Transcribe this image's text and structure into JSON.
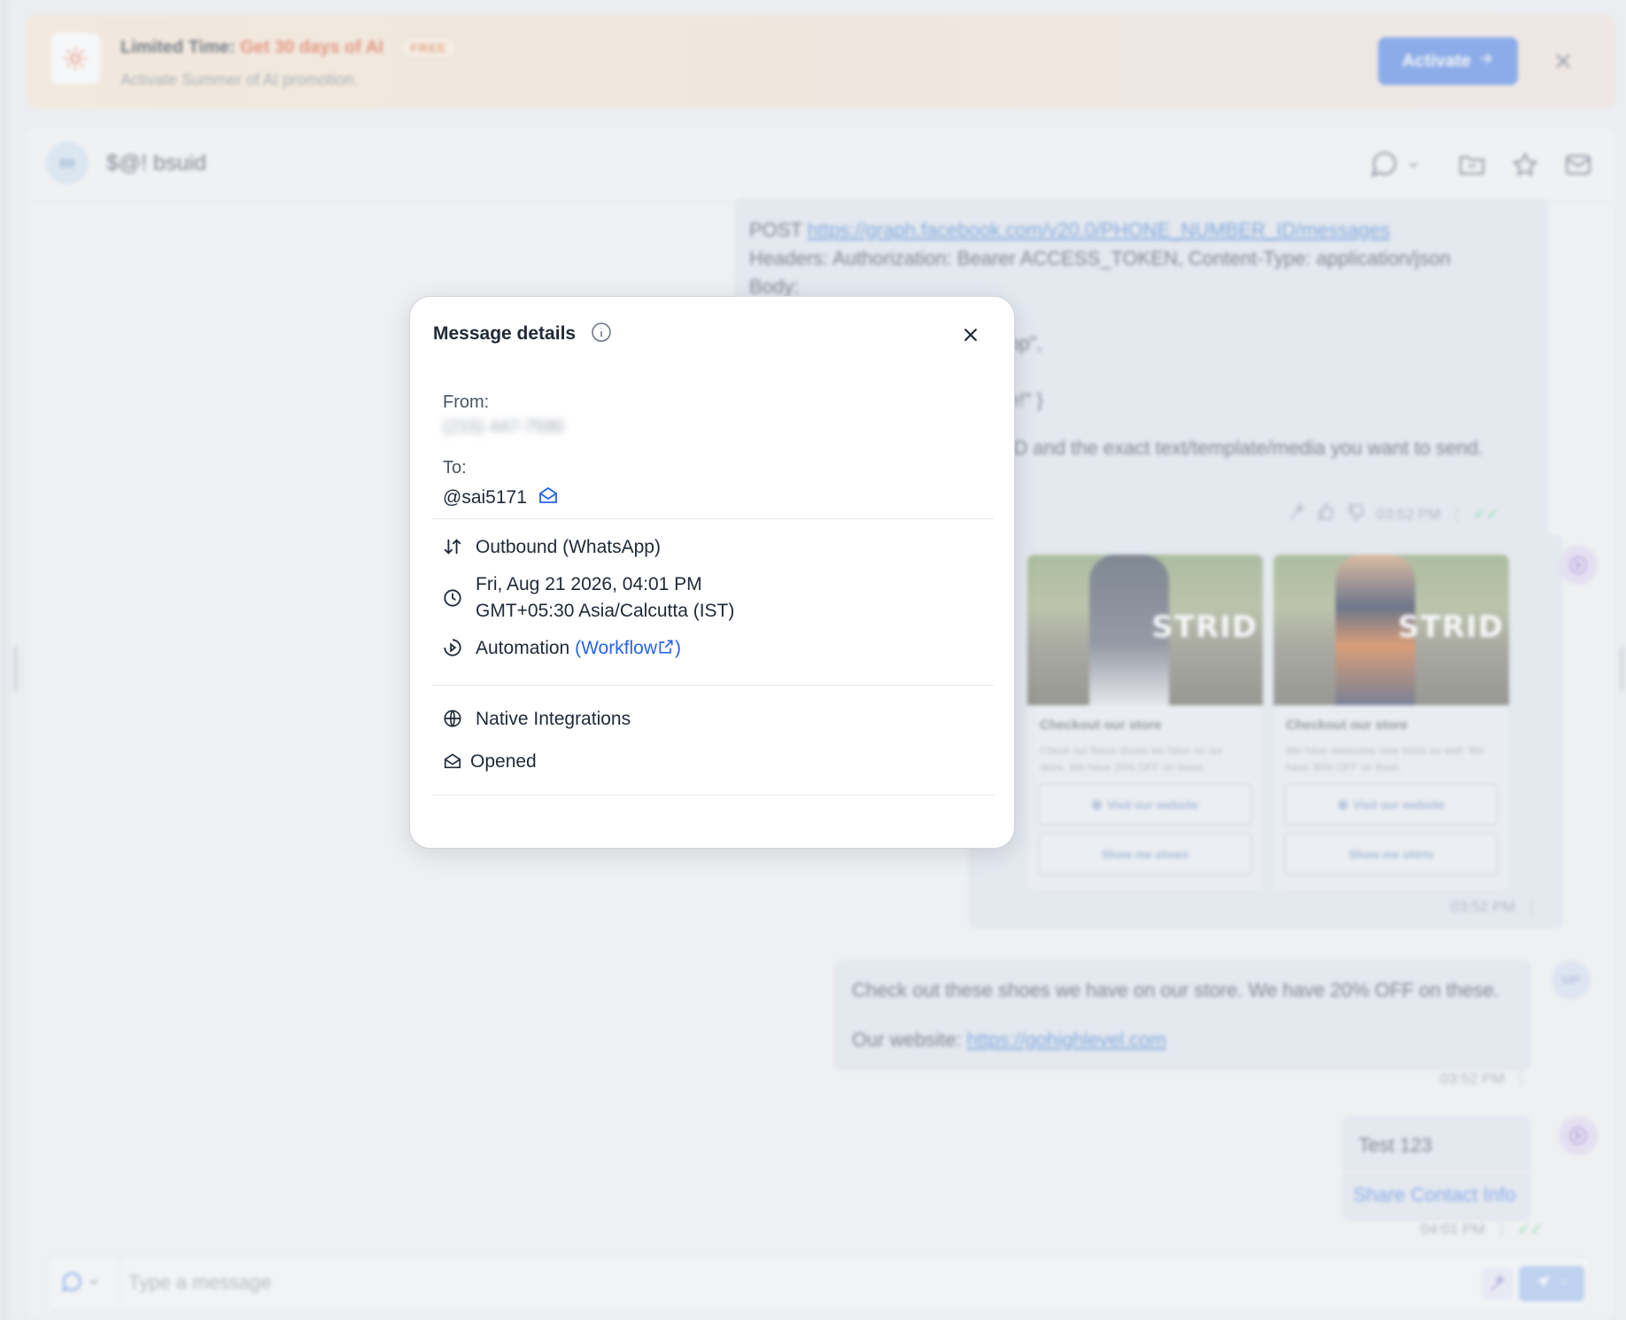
{
  "promo": {
    "title_prefix": "Limited Time:",
    "title_highlight": "Get 30 days of AI",
    "badge": "FREE",
    "subtitle": "Activate Summer of AI promotion.",
    "activate_label": "Activate"
  },
  "header": {
    "avatar_initials": "$B",
    "contact_name": "$@! bsuid"
  },
  "messages": {
    "code": {
      "line1_prefix": "POST",
      "line1_link": "https://graph.facebook.com/v20.0/PHONE_NUMBER_ID/messages",
      "line2": "Headers: Authorization: Bearer ACCESS_TOKEN, Content-Type: application/json",
      "line3": "Body:",
      "line4": "{",
      "line5": "app\",",
      "line6": "ee!\" }",
      "line7": "_ID and the exact text/template/media you want to send.",
      "time": "03:52 PM"
    },
    "carousel": {
      "cards": [
        {
          "image_text": "STRID",
          "title": "Checkout our store",
          "desc": "Check out these shoes we have on our store. We have 20% OFF on these.",
          "btn1": "Visit our website",
          "btn2": "Show me shoes"
        },
        {
          "image_text": "STRID",
          "title": "Checkout our store",
          "desc": "We have awesome new shirts as well. We have 30% OFF on them.",
          "btn1": "Visit our website",
          "btn2": "Show me shirts"
        }
      ],
      "time": "03:52 PM"
    },
    "promo_text": {
      "line1": "Check out these shoes we have on our store. We have 20% OFF on these.",
      "line2_prefix": "Our website:",
      "line2_link": "https://gohighlevel.com",
      "time": "03:52 PM",
      "avatar_initials": "MP"
    },
    "test": {
      "text": "Test 123",
      "button": "Share Contact Info",
      "time": "04:01 PM"
    }
  },
  "composer": {
    "placeholder": "Type a message"
  },
  "modal": {
    "title": "Message details",
    "from_label": "From:",
    "from_value": "(215) 447-7590",
    "to_label": "To:",
    "to_value": "@sai5171",
    "direction": "Outbound (WhatsApp)",
    "date": "Fri, Aug 21 2026, 04:01 PM",
    "timezone": "GMT+05:30 Asia/Calcutta (IST)",
    "source_prefix": "Automation",
    "source_link": "(Workflow",
    "source_suffix": ")",
    "integration": "Native Integrations",
    "status": "Opened"
  },
  "colors": {
    "accent": "#2563eb",
    "promo_highlight": "#e36b4a",
    "activate_bg": "#5b8de8"
  }
}
